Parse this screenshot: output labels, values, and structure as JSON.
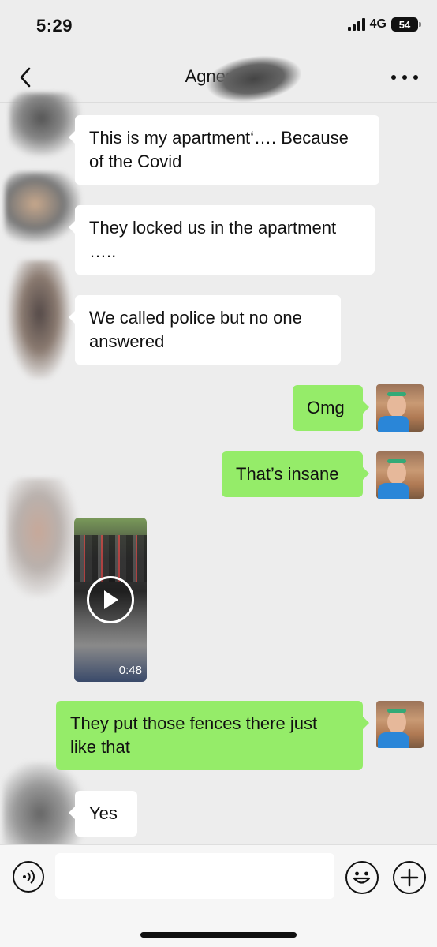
{
  "status_bar": {
    "time": "5:29",
    "network": "4G",
    "battery": "54"
  },
  "header": {
    "title": "Agnes",
    "title_emoji": "💕",
    "back_icon": "chevron-left-icon",
    "more_icon": "more-dots-icon"
  },
  "messages": [
    {
      "side": "incoming",
      "type": "text",
      "line1": "This is my apartment‘…. Because",
      "line2": "of the Covid"
    },
    {
      "side": "incoming",
      "type": "text",
      "line1": "They locked us in the apartment",
      "line2": "….."
    },
    {
      "side": "incoming",
      "type": "text",
      "line1": "We called police but no one",
      "line2": "answered"
    },
    {
      "side": "outgoing",
      "type": "text",
      "text": "Omg"
    },
    {
      "side": "outgoing",
      "type": "text",
      "text": "That’s insane"
    },
    {
      "side": "incoming",
      "type": "video",
      "duration": "0:48"
    },
    {
      "side": "outgoing",
      "type": "text",
      "line1": "They put those fences there just",
      "line2": "like that"
    },
    {
      "side": "incoming",
      "type": "text",
      "text": "Yes"
    }
  ],
  "input_bar": {
    "voice_icon": "voice-icon",
    "text_value": "",
    "emoji_icon": "emoji-icon",
    "plus_icon": "plus-icon"
  },
  "colors": {
    "background": "#ededed",
    "incoming_bubble": "#ffffff",
    "outgoing_bubble": "#95ec69"
  }
}
